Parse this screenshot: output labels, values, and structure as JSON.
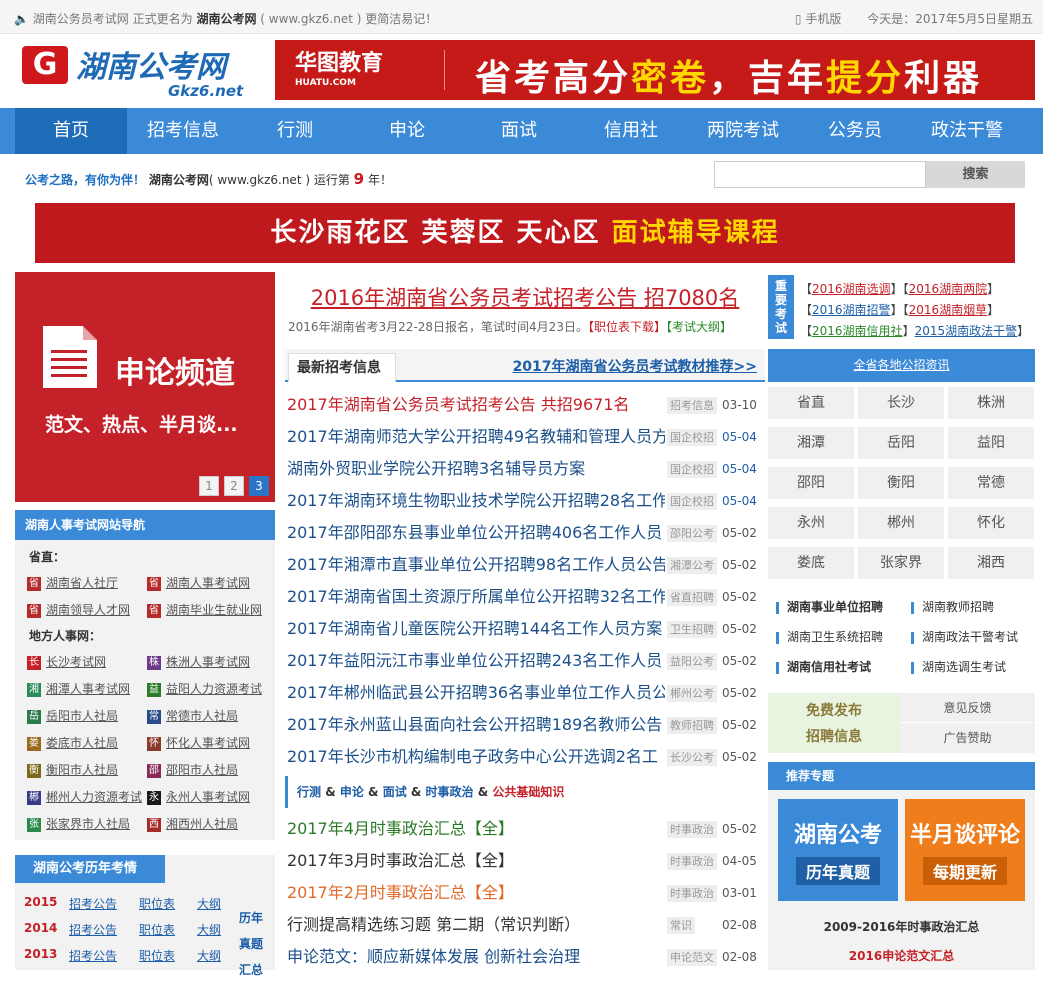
{
  "topbar": {
    "notice_prefix": "湖南公务员考试网 正式更名为",
    "notice_name": "湖南公考网",
    "notice_suffix": "( www.gkz6.net ) 更简洁易记！",
    "mobile": "手机版",
    "today": "今天是：2017年5月5日星期五"
  },
  "logo": {
    "mark": "G",
    "name": "湖南公考网",
    "domain": "Gkz6.net"
  },
  "banner_top": {
    "brand": "华图教育",
    "brand_sub": "HUATU.COM",
    "slogan_a": "省考高分",
    "slogan_b": "密卷",
    "slogan_c": "，吉年",
    "slogan_d": "提分",
    "slogan_e": "利器"
  },
  "nav": [
    "首页",
    "招考信息",
    "行测",
    "申论",
    "面试",
    "信用社",
    "两院考试",
    "公务员",
    "政法干警"
  ],
  "slogan": {
    "a": "公考之路，有你为伴！",
    "b": "湖南公考网",
    "c": "( www.gkz6.net ) 运行第",
    "num": "9",
    "d": "年！"
  },
  "search": {
    "placeholder": "",
    "button": "搜索"
  },
  "banner_mid": {
    "a": "长沙雨花区  芙蓉区  天心区  ",
    "b": "面试辅导课程"
  },
  "promo": {
    "title": "申论频道",
    "subtitle": "范文、热点、半月谈...",
    "pages": [
      "1",
      "2",
      "3"
    ]
  },
  "navbox": {
    "title": "湖南人事考试网站导航",
    "province_label": "省直：",
    "province": [
      {
        "tag": "省",
        "color": "#b52a2a",
        "label": "湖南省人社厅"
      },
      {
        "tag": "省",
        "color": "#b52a2a",
        "label": "湖南人事考试网"
      },
      {
        "tag": "省",
        "color": "#b52a2a",
        "label": "湖南领导人才网"
      },
      {
        "tag": "省",
        "color": "#b52a2a",
        "label": "湖南毕业生就业网"
      }
    ],
    "local_label": "地方人事网：",
    "local": [
      {
        "tag": "长",
        "color": "#c42128",
        "label": "长沙考试网"
      },
      {
        "tag": "株",
        "color": "#6b3a8a",
        "label": "株洲人事考试网"
      },
      {
        "tag": "湘",
        "color": "#2a8a5a",
        "label": "湘潭人事考试网"
      },
      {
        "tag": "益",
        "color": "#2a7a2a",
        "label": "益阳人力资源考试"
      },
      {
        "tag": "岳",
        "color": "#2a7a4a",
        "label": "岳阳市人社局"
      },
      {
        "tag": "常",
        "color": "#2a4a8a",
        "label": "常德市人社局"
      },
      {
        "tag": "娄",
        "color": "#9a6a1a",
        "label": "娄底市人社局"
      },
      {
        "tag": "怀",
        "color": "#8a3a2a",
        "label": "怀化人事考试网"
      },
      {
        "tag": "衡",
        "color": "#7a6a1a",
        "label": "衡阳市人社局"
      },
      {
        "tag": "邵",
        "color": "#8a2a5a",
        "label": "邵阳市人社局"
      },
      {
        "tag": "郴",
        "color": "#3a3a8a",
        "label": "郴州人力资源考试"
      },
      {
        "tag": "永",
        "color": "#1a1a1a",
        "label": "永州人事考试网"
      },
      {
        "tag": "张",
        "color": "#2a8a4a",
        "label": "张家界市人社局"
      },
      {
        "tag": "西",
        "color": "#a52a2a",
        "label": "湘西州人社局"
      }
    ]
  },
  "history": {
    "title": "湖南公考历年考情",
    "rows": [
      {
        "year": "2015",
        "a": "招考公告",
        "b": "职位表",
        "c": "大纲"
      },
      {
        "year": "2014",
        "a": "招考公告",
        "b": "职位表",
        "c": "大纲"
      },
      {
        "year": "2013",
        "a": "招考公告",
        "b": "职位表",
        "c": "大纲"
      }
    ],
    "side": [
      "历年",
      "真题",
      "汇总"
    ]
  },
  "headline": {
    "title": "2016年湖南省公务员考试招考公告 招7080名",
    "sub_a": "2016年湖南省考3月22-28日报名，笔试时间4月23日。",
    "sub_b": "【职位表下载】",
    "sub_c": "【考试大纲】"
  },
  "tabs": {
    "active": "最新招考信息",
    "more": "2017年湖南省公务员考试教材推荐>>"
  },
  "news": [
    {
      "title": "2017年湖南省公务员考试招考公告 共招9671名",
      "color": "#c42128",
      "cat": "招考信息",
      "date": "03-10",
      "blue": false
    },
    {
      "title": "2017年湖南师范大学公开招聘49名教辅和管理人员方",
      "color": "#1b4f8a",
      "cat": "国企校招",
      "date": "05-04",
      "blue": true
    },
    {
      "title": "湖南外贸职业学院公开招聘3名辅导员方案",
      "color": "#1b4f8a",
      "cat": "国企校招",
      "date": "05-04",
      "blue": true
    },
    {
      "title": "2017年湖南环境生物职业技术学院公开招聘28名工作",
      "color": "#1b4f8a",
      "cat": "国企校招",
      "date": "05-04",
      "blue": true
    },
    {
      "title": "2017年邵阳邵东县事业单位公开招聘406名工作人员",
      "color": "#1b4f8a",
      "cat": "邵阳公考",
      "date": "05-02",
      "blue": false
    },
    {
      "title": "2017年湘潭市直事业单位公开招聘98名工作人员公告",
      "color": "#1b4f8a",
      "cat": "湘潭公考",
      "date": "05-02",
      "blue": false
    },
    {
      "title": "2017年湖南省国土资源厅所属单位公开招聘32名工作",
      "color": "#1b4f8a",
      "cat": "省直招聘",
      "date": "05-02",
      "blue": false
    },
    {
      "title": "2017年湖南省儿童医院公开招聘144名工作人员方案",
      "color": "#1b4f8a",
      "cat": "卫生招聘",
      "date": "05-02",
      "blue": false
    },
    {
      "title": "2017年益阳沅江市事业单位公开招聘243名工作人员",
      "color": "#1b4f8a",
      "cat": "益阳公考",
      "date": "05-02",
      "blue": false
    },
    {
      "title": "2017年郴州临武县公开招聘36名事业单位工作人员公",
      "color": "#1b4f8a",
      "cat": "郴州公考",
      "date": "05-02",
      "blue": false
    },
    {
      "title": "2017年永州蓝山县面向社会公开招聘189名教师公告",
      "color": "#1b4f8a",
      "cat": "教师招聘",
      "date": "05-02",
      "blue": false
    },
    {
      "title": "2017年长沙市机构编制电子政务中心公开选调2名工",
      "color": "#1b4f8a",
      "cat": "长沙公考",
      "date": "05-02",
      "blue": false
    }
  ],
  "catbar": {
    "a": "行测",
    "amp1": " & ",
    "b": "申论",
    "amp2": " & ",
    "c": "面试",
    "amp3": " & ",
    "d": "时事政治",
    "amp4": " & ",
    "e": "公共基础知识"
  },
  "news2": [
    {
      "title": "2017年4月时事政治汇总【全】",
      "color": "#2a7a2a",
      "cat": "时事政治",
      "date": "05-02"
    },
    {
      "title": "2017年3月时事政治汇总【全】",
      "color": "#333333",
      "cat": "时事政治",
      "date": "04-05"
    },
    {
      "title": "2017年2月时事政治汇总【全】",
      "color": "#e06a2a",
      "cat": "时事政治",
      "date": "03-01"
    },
    {
      "title": "行测提高精选练习题 第二期（常识判断）",
      "color": "#333333",
      "cat": "常识",
      "date": "02-08"
    },
    {
      "title": "申论范文：顺应新媒体发展 创新社会治理",
      "color": "#1b4f8a",
      "cat": "申论范文",
      "date": "02-08"
    }
  ],
  "important": {
    "label": [
      "重",
      "要",
      "考",
      "试"
    ],
    "rows": [
      [
        "【",
        "2016湖南选调",
        "】【",
        "2016湖南两院",
        "】"
      ],
      [
        "【",
        "2016湖南招警",
        "】【",
        "2016湖南烟草",
        "】"
      ],
      [
        "【",
        "2016湖南信用社",
        "】",
        "2015湖南政法干警",
        "】"
      ]
    ]
  },
  "regions": {
    "title": "全省各地公招资讯",
    "items": [
      "省直",
      "长沙",
      "株洲",
      "湘潭",
      "岳阳",
      "益阳",
      "邵阳",
      "衡阳",
      "常德",
      "永州",
      "郴州",
      "怀化",
      "娄底",
      "张家界",
      "湘西"
    ]
  },
  "quicklinks": [
    "湖南事业单位招聘",
    "湖南教师招聘",
    "湖南卫生系统招聘",
    "湖南政法干警考试",
    "湖南信用社考试",
    "湖南选调生考试"
  ],
  "free": {
    "line1": "免费发布",
    "line2": "招聘信息",
    "feedback": "意见反馈",
    "ads": "广告赞助"
  },
  "recommend": {
    "title": "推荐专题",
    "box1_a": "湖南公考",
    "box1_b": "历年真题",
    "box2_a": "半月谈评论",
    "box2_b": "每期更新",
    "link1": "2009-2016年时事政治汇总",
    "link2": "2016申论范文汇总"
  }
}
